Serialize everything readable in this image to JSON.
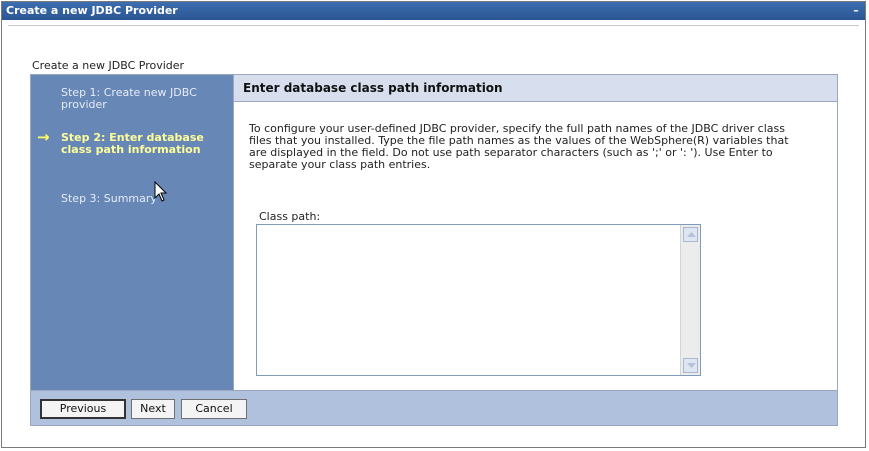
{
  "window": {
    "title": "Create a new JDBC Provider",
    "minimize_glyph": "–"
  },
  "page": {
    "heading": "Create a new JDBC Provider"
  },
  "steps": [
    {
      "label": "Step 1: Create new JDBC provider",
      "state": "done"
    },
    {
      "label": "Step 2: Enter database class path information",
      "state": "current"
    },
    {
      "label": "Step 3: Summary",
      "state": "pending"
    }
  ],
  "content": {
    "header": "Enter database class path information",
    "description": "To configure your user-defined JDBC provider, specify the full path names of the JDBC driver class files that you installed. Type the file path names as the values of the WebSphere(R) variables that are displayed in the field. Do not use path separator characters (such as ';' or ': '). Use Enter to separate your class path entries.",
    "class_path_label": "Class path:",
    "class_path_value": ""
  },
  "buttons": {
    "previous": "Previous",
    "next": "Next",
    "cancel": "Cancel"
  },
  "icons": {
    "current_step": "arrow-right-icon",
    "pointer": "mouse-cursor-icon"
  },
  "colors": {
    "title_bar": "#2a5592",
    "sidebar": "#6787b7",
    "current_step_text": "#ffff99",
    "content_header": "#d7dfee",
    "footer": "#b0c1dd"
  }
}
